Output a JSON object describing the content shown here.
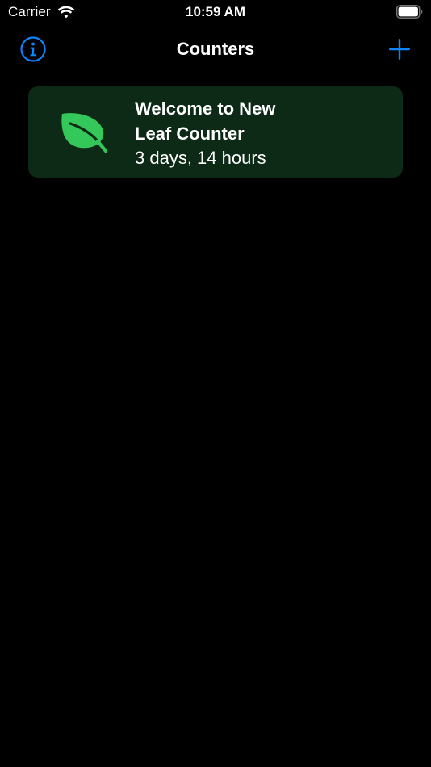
{
  "status_bar": {
    "carrier": "Carrier",
    "time": "10:59 AM",
    "wifi_icon": "wifi-icon",
    "battery_icon": "battery-icon"
  },
  "nav": {
    "title": "Counters",
    "info_icon": "info-icon",
    "add_icon": "plus-icon",
    "accent_color": "#0a84ff"
  },
  "counters": [
    {
      "title_line1": "Welcome to New",
      "title_line2": "Leaf Counter",
      "elapsed": "3 days, 14 hours",
      "icon": "leaf-icon",
      "icon_color": "#34c759",
      "card_color": "#0d2a16"
    }
  ]
}
